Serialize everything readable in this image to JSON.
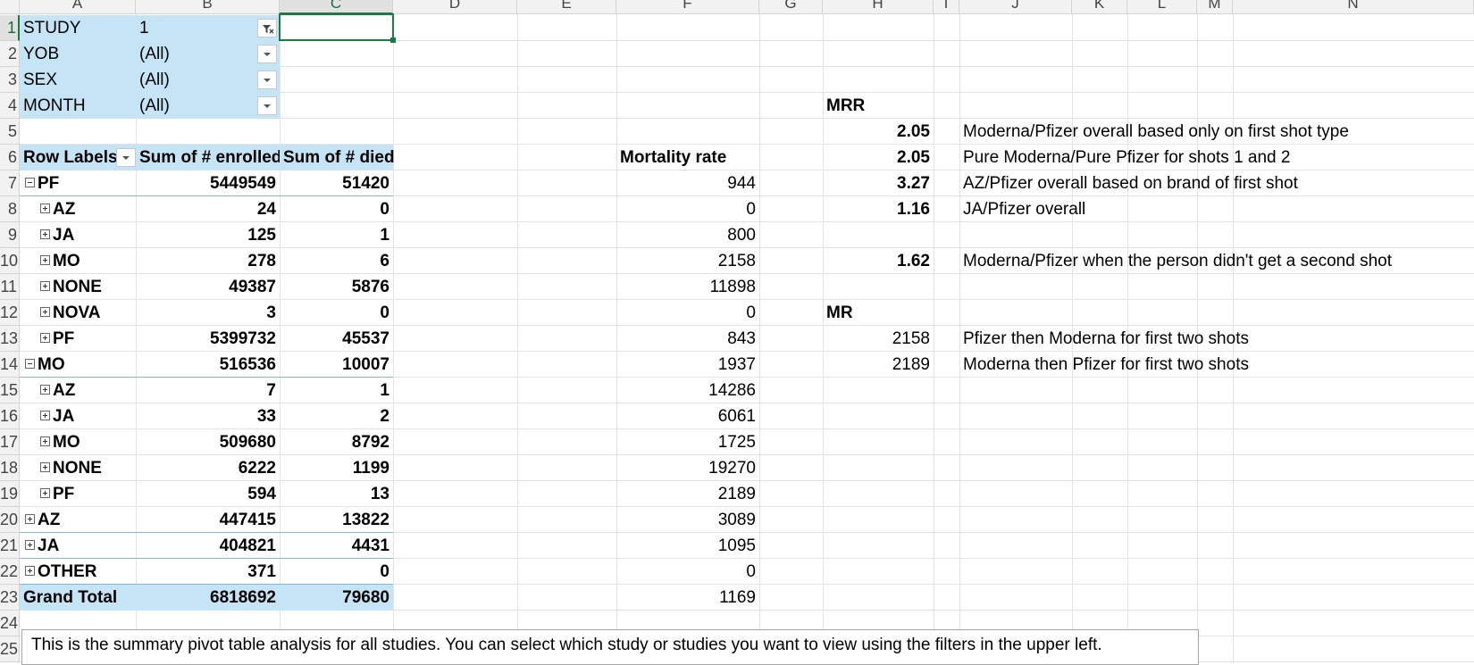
{
  "columns": [
    "A",
    "B",
    "C",
    "D",
    "E",
    "F",
    "G",
    "H",
    "I",
    "J",
    "K",
    "L",
    "M",
    "N"
  ],
  "rows": [
    "1",
    "2",
    "3",
    "4",
    "5",
    "6",
    "7",
    "8",
    "9",
    "10",
    "11",
    "12",
    "13",
    "14",
    "15",
    "16",
    "17",
    "18",
    "19",
    "20",
    "21",
    "22",
    "23",
    "24",
    "25"
  ],
  "filters": [
    {
      "field": "STUDY",
      "value": "1",
      "filtered": true
    },
    {
      "field": "YOB",
      "value": "(All)",
      "filtered": false
    },
    {
      "field": "SEX",
      "value": "(All)",
      "filtered": false
    },
    {
      "field": "MONTH",
      "value": "(All)",
      "filtered": false
    }
  ],
  "pivot": {
    "headers": {
      "row_labels": "Row Labels",
      "enrolled": "Sum of # enrolled",
      "died": "Sum of # died"
    },
    "rows": [
      {
        "label": "PF",
        "level": 0,
        "toggle": "minus",
        "enrolled": "5449549",
        "died": "51420"
      },
      {
        "label": "AZ",
        "level": 1,
        "toggle": "plus",
        "enrolled": "24",
        "died": "0"
      },
      {
        "label": "JA",
        "level": 1,
        "toggle": "plus",
        "enrolled": "125",
        "died": "1"
      },
      {
        "label": "MO",
        "level": 1,
        "toggle": "plus",
        "enrolled": "278",
        "died": "6"
      },
      {
        "label": "NONE",
        "level": 1,
        "toggle": "plus",
        "enrolled": "49387",
        "died": "5876"
      },
      {
        "label": "NOVA",
        "level": 1,
        "toggle": "plus",
        "enrolled": "3",
        "died": "0"
      },
      {
        "label": "PF",
        "level": 1,
        "toggle": "plus",
        "enrolled": "5399732",
        "died": "45537"
      },
      {
        "label": "MO",
        "level": 0,
        "toggle": "minus",
        "enrolled": "516536",
        "died": "10007"
      },
      {
        "label": "AZ",
        "level": 1,
        "toggle": "plus",
        "enrolled": "7",
        "died": "1"
      },
      {
        "label": "JA",
        "level": 1,
        "toggle": "plus",
        "enrolled": "33",
        "died": "2"
      },
      {
        "label": "MO",
        "level": 1,
        "toggle": "plus",
        "enrolled": "509680",
        "died": "8792"
      },
      {
        "label": "NONE",
        "level": 1,
        "toggle": "plus",
        "enrolled": "6222",
        "died": "1199"
      },
      {
        "label": "PF",
        "level": 1,
        "toggle": "plus",
        "enrolled": "594",
        "died": "13"
      },
      {
        "label": "AZ",
        "level": 0,
        "toggle": "plus",
        "enrolled": "447415",
        "died": "13822"
      },
      {
        "label": "JA",
        "level": 0,
        "toggle": "plus",
        "enrolled": "404821",
        "died": "4431"
      },
      {
        "label": "OTHER",
        "level": 0,
        "toggle": "plus",
        "enrolled": "371",
        "died": "0"
      }
    ],
    "grand_total": {
      "label": "Grand Total",
      "enrolled": "6818692",
      "died": "79680"
    }
  },
  "mortality": {
    "header": "Mortality rate",
    "values": [
      "944",
      "0",
      "800",
      "2158",
      "11898",
      "0",
      "843",
      "1937",
      "14286",
      "6061",
      "1725",
      "19270",
      "2189",
      "3089",
      "1095",
      "0",
      "1169"
    ]
  },
  "mrr": {
    "header": "MRR",
    "items": [
      {
        "value": "2.05",
        "note": "Moderna/Pfizer overall based only on first shot type"
      },
      {
        "value": "2.05",
        "note": "Pure Moderna/Pure Pfizer for shots 1 and 2"
      },
      {
        "value": "3.27",
        "note": "AZ/Pfizer overall based on brand of first shot"
      },
      {
        "value": "1.16",
        "note": "JA/Pfizer overall"
      },
      {
        "value": "1.62",
        "note": "Moderna/Pfizer when the person didn't get a second shot"
      }
    ]
  },
  "mr": {
    "header": "MR",
    "items": [
      {
        "value": "2158",
        "note": "Pfizer then Moderna for first two shots"
      },
      {
        "value": "2189",
        "note": "Moderna then Pfizer for first two shots"
      }
    ]
  },
  "textbox": "This is the summary pivot table analysis for all studies. You can select which study or studies you want to view using the filters in the upper left."
}
